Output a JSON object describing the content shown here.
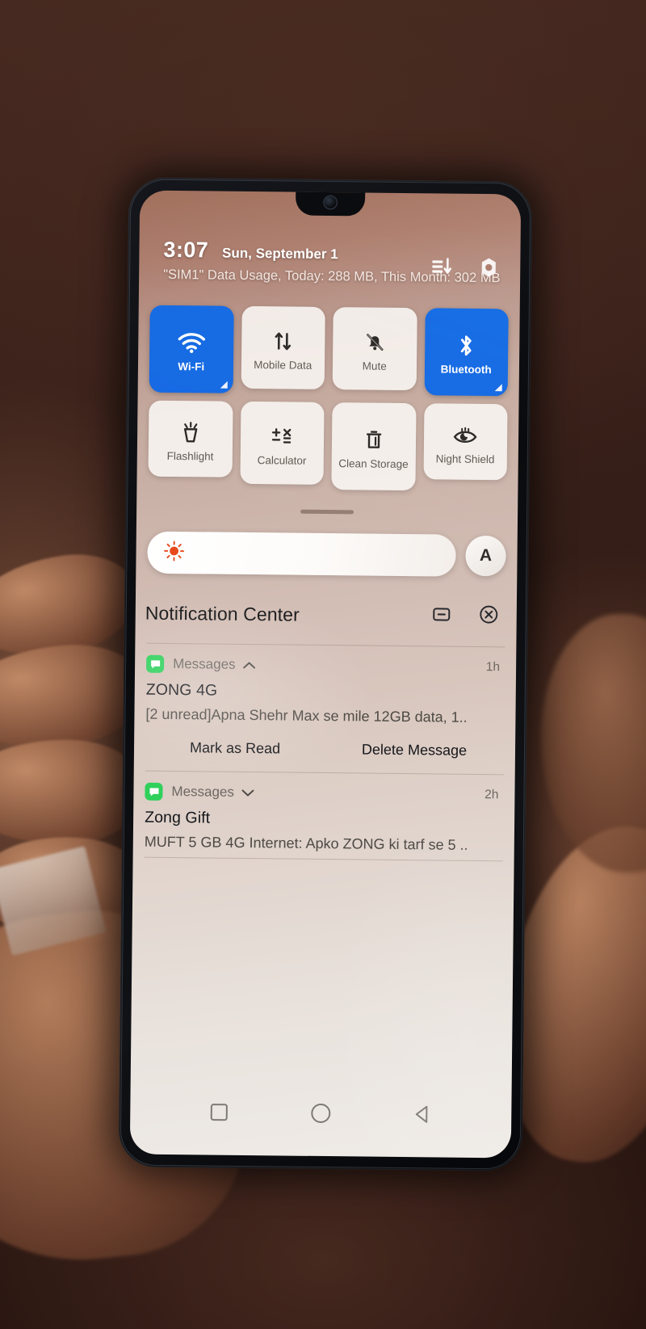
{
  "status_bar": {
    "time": "3:07",
    "date": "Sun, September 1",
    "sim_info": "\"SIM1\" Data Usage, Today: 288 MB, This Month: 302 MB",
    "icons": [
      "signal-bars-icon",
      "settings-gear-icon"
    ]
  },
  "quick_settings": {
    "tiles": [
      {
        "label": "Wi-Fi",
        "icon": "wifi-icon",
        "state": "on",
        "has_corner_badge": true
      },
      {
        "label": "Mobile Data",
        "icon": "data-arrows-icon",
        "state": "off",
        "has_corner_badge": false
      },
      {
        "label": "Mute",
        "icon": "bell-muted-icon",
        "state": "off",
        "has_corner_badge": false
      },
      {
        "label": "Bluetooth",
        "icon": "bluetooth-icon",
        "state": "on",
        "has_corner_badge": true
      },
      {
        "label": "Flashlight",
        "icon": "flashlight-icon",
        "state": "off",
        "has_corner_badge": false
      },
      {
        "label": "Calculator",
        "icon": "calculator-icon",
        "state": "off",
        "has_corner_badge": false
      },
      {
        "label": "Clean Storage",
        "icon": "trash-icon",
        "state": "off",
        "has_corner_badge": false
      },
      {
        "label": "Night Shield",
        "icon": "night-eye-icon",
        "state": "off",
        "has_corner_badge": false
      }
    ]
  },
  "brightness": {
    "icon": "brightness-sun-icon",
    "level_percent": 100,
    "auto_label": "A"
  },
  "notification_center": {
    "title": "Notification Center",
    "header_icons": [
      "notification-settings-icon",
      "clear-all-icon"
    ],
    "notifications": [
      {
        "app": "Messages",
        "app_icon": "messages-bubble-icon",
        "expanded": true,
        "chevron": "chevron-up-icon",
        "time": "1h",
        "title": "ZONG 4G",
        "body": "[2 unread]Apna Shehr Max se mile 12GB data, 1..",
        "actions": [
          "Mark as Read",
          "Delete Message"
        ]
      },
      {
        "app": "Messages",
        "app_icon": "messages-bubble-icon",
        "expanded": false,
        "chevron": "chevron-down-icon",
        "time": "2h",
        "title": "Zong Gift",
        "body": "MUFT 5 GB 4G Internet: Apko ZONG ki tarf se 5 ..",
        "actions": []
      }
    ]
  },
  "nav_bar": {
    "buttons": [
      {
        "name": "recents-square-icon"
      },
      {
        "name": "home-circle-icon"
      },
      {
        "name": "back-triangle-icon"
      }
    ]
  },
  "colors": {
    "accent_blue": "#1668e3",
    "messages_green": "#2ed05a",
    "brightness_orange": "#e8491b"
  }
}
